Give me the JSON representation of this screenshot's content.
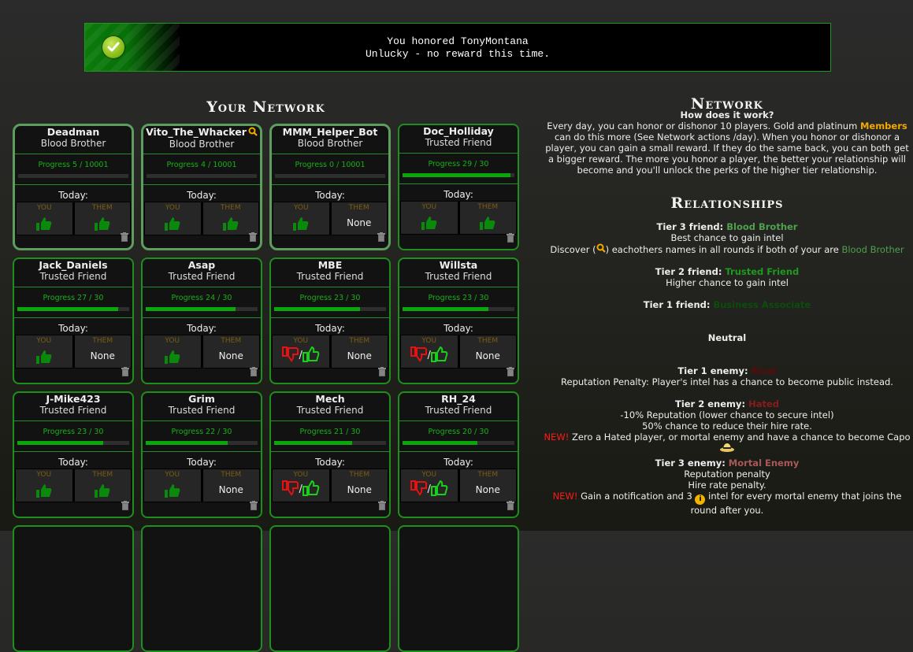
{
  "notice": {
    "line1": "You honored TonyMontana",
    "line2": "Unlucky - no reward this time.",
    "icon": "check-circle-icon"
  },
  "your_network": {
    "title": "Your Network",
    "today_label": "Today:",
    "you_label": "YOU",
    "them_label": "THEM",
    "none_label": "None",
    "cards": [
      {
        "name": "Deadman",
        "relationship": "Blood Brother",
        "tier": "bb",
        "progress_text": "Progress 5 / 10001",
        "progress": 0.0005,
        "you": "thumb-up",
        "them": "thumb-up",
        "discover": false
      },
      {
        "name": "Vito_The_Whacker",
        "relationship": "Blood Brother",
        "tier": "bb",
        "progress_text": "Progress 4 / 10001",
        "progress": 0.0004,
        "you": "thumb-up",
        "them": "thumb-up",
        "discover": true
      },
      {
        "name": "MMM_Helper_Bot",
        "relationship": "Blood Brother",
        "tier": "bb",
        "progress_text": "Progress 0 / 10001",
        "progress": 0,
        "you": "thumb-up",
        "them": "none",
        "discover": false
      },
      {
        "name": "Doc_Holliday",
        "relationship": "Trusted Friend",
        "tier": "tf",
        "progress_text": "Progress 29 / 30",
        "progress": 0.9667,
        "you": "thumb-up",
        "them": "thumb-up",
        "discover": false
      },
      {
        "name": "Jack_Daniels",
        "relationship": "Trusted Friend",
        "tier": "tf",
        "progress_text": "Progress 27 / 30",
        "progress": 0.9,
        "you": "thumb-up",
        "them": "none",
        "discover": false
      },
      {
        "name": "Asap",
        "relationship": "Trusted Friend",
        "tier": "tf",
        "progress_text": "Progress 24 / 30",
        "progress": 0.8,
        "you": "thumb-up",
        "them": "none",
        "discover": false
      },
      {
        "name": "MBE",
        "relationship": "Trusted Friend",
        "tier": "tf",
        "progress_text": "Progress 23 / 30",
        "progress": 0.7667,
        "you": "choice",
        "them": "none",
        "discover": false
      },
      {
        "name": "Willsta",
        "relationship": "Trusted Friend",
        "tier": "tf",
        "progress_text": "Progress 23 / 30",
        "progress": 0.7667,
        "you": "choice",
        "them": "none",
        "discover": false
      },
      {
        "name": "J-Mike423",
        "relationship": "Trusted Friend",
        "tier": "tf",
        "progress_text": "Progress 23 / 30",
        "progress": 0.7667,
        "you": "thumb-up",
        "them": "thumb-up",
        "discover": false
      },
      {
        "name": "Grim",
        "relationship": "Trusted Friend",
        "tier": "tf",
        "progress_text": "Progress 22 / 30",
        "progress": 0.7333,
        "you": "thumb-up",
        "them": "none",
        "discover": false
      },
      {
        "name": "Mech",
        "relationship": "Trusted Friend",
        "tier": "tf",
        "progress_text": "Progress 21 / 30",
        "progress": 0.7,
        "you": "choice",
        "them": "none",
        "discover": false
      },
      {
        "name": "RH_24",
        "relationship": "Trusted Friend",
        "tier": "tf",
        "progress_text": "Progress 20 / 30",
        "progress": 0.6667,
        "you": "choice",
        "them": "none",
        "discover": false
      }
    ]
  },
  "network_info": {
    "title": "Network",
    "how_title": "How does it work?",
    "how_text_1": "Every day, you can honor or dishonor 10 players. Gold and platinum ",
    "members_link": "Members",
    "how_text_2": " can do this more (See Network actions /day). When you honor or dishonor a player, you can gain a small reward. If they do the same back, you can both get a bigger reward. The more you honor a player, the better your relationship will become and you'll unlock the perks of the higher tier relationship."
  },
  "relationships": {
    "title": "Relationships",
    "tier3_friend_label": "Tier 3 friend: ",
    "tier3_friend_name": "Blood Brother",
    "tier3_friend_line1": "Best chance to gain intel",
    "tier3_friend_line2a": "Discover (",
    "tier3_friend_line2b": ") eachothers names in all rounds if both of your are ",
    "tier3_friend_line2c": "Blood Brother",
    "tier2_friend_label": "Tier 2 friend: ",
    "tier2_friend_name": "Trusted Friend",
    "tier2_friend_line1": "Higher chance to gain intel",
    "tier1_friend_label": "Tier 1 friend: ",
    "tier1_friend_name": "Business Associate",
    "neutral": "Neutral",
    "tier1_enemy_label": "Tier 1 enemy: ",
    "tier1_enemy_name": "Rival",
    "tier1_enemy_line1": "Reputation Penalty: Player's intel has a chance to become public instead.",
    "tier2_enemy_label": "Tier 2 enemy: ",
    "tier2_enemy_name": "Hated",
    "tier2_enemy_line1": "-10% Reputation (lower chance to secure intel)",
    "tier2_enemy_line2": "50% chance to reduce their hire rate.",
    "new_label": "NEW!",
    "tier2_enemy_line3": " Zero a Hated player, or mortal enemy and have a chance to become Capo",
    "tier3_enemy_label": "Tier 3 enemy: ",
    "tier3_enemy_name": "Mortal Enemy",
    "tier3_enemy_line1": "Reputation penalty",
    "tier3_enemy_line2": "Hire rate penalty.",
    "tier3_enemy_line3a": " Gain a notification and 3 ",
    "info_glyph": "i",
    "tier3_enemy_line3b": " intel for every mortal enemy that joins the round after you."
  },
  "colors": {
    "accent_green": "#1e8f1e",
    "blood_brother": "#4fa04f",
    "trusted_friend": "#1e9a1e",
    "members_gold": "#f2a900",
    "new_red": "#ff1a1a"
  }
}
